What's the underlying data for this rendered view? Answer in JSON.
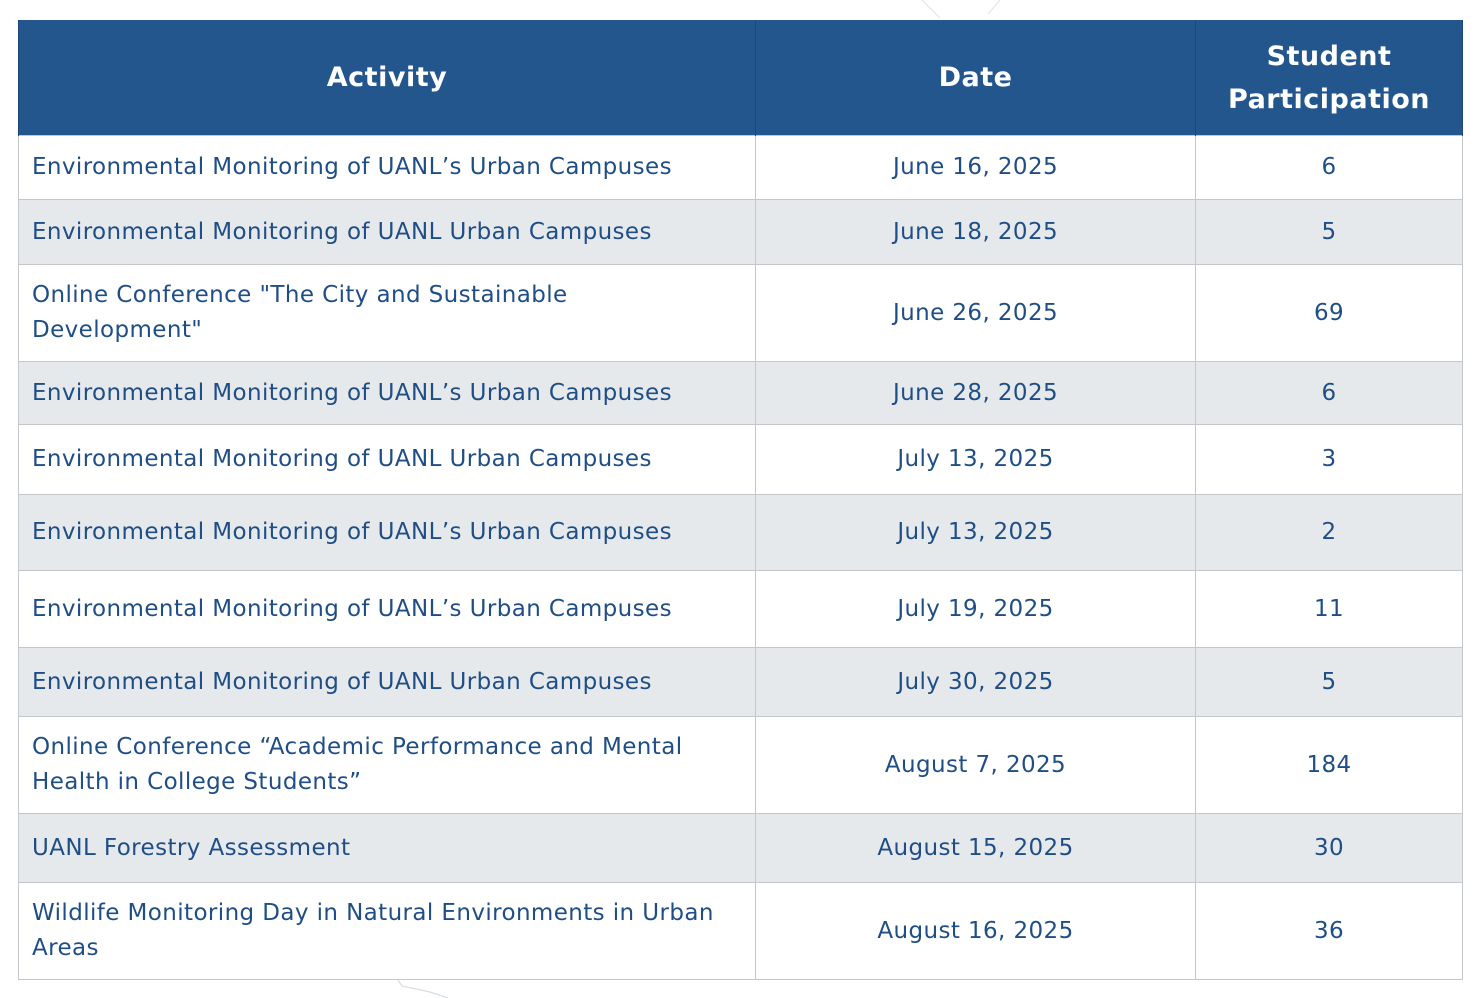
{
  "table": {
    "headers": {
      "activity": "Activity",
      "date": "Date",
      "participation": "Student Participation"
    },
    "rows": [
      {
        "activity": "Environmental Monitoring of UANL’s Urban Campuses",
        "date": "June 16, 2025",
        "participation": "6"
      },
      {
        "activity": "Environmental Monitoring of UANL Urban Campuses",
        "date": "June 18, 2025",
        "participation": "5"
      },
      {
        "activity": "Online Conference \"The City and Sustainable Development\"",
        "date": "June 26, 2025",
        "participation": "69"
      },
      {
        "activity": "Environmental Monitoring of UANL’s Urban Campuses",
        "date": "June 28, 2025",
        "participation": "6"
      },
      {
        "activity": "Environmental Monitoring of UANL Urban Campuses",
        "date": "July 13, 2025",
        "participation": "3"
      },
      {
        "activity": "Environmental Monitoring of UANL’s Urban Campuses",
        "date": "July 13, 2025",
        "participation": "2"
      },
      {
        "activity": "Environmental Monitoring of UANL’s Urban Campuses",
        "date": "July 19, 2025",
        "participation": "11"
      },
      {
        "activity": "Environmental Monitoring of UANL Urban Campuses",
        "date": "July 30, 2025",
        "participation": "5"
      },
      {
        "activity": "Online Conference “Academic Performance and Mental Health in College Students”",
        "date": "August 7, 2025",
        "participation": "184"
      },
      {
        "activity": "UANL Forestry Assessment",
        "date": "August 15, 2025",
        "participation": "30"
      },
      {
        "activity": "Wildlife Monitoring Day in Natural Environments in Urban Areas",
        "date": "August 16, 2025",
        "participation": "36"
      }
    ]
  },
  "colors": {
    "header_background": "#23568d",
    "header_text": "#ffffff",
    "body_text": "#1f4e86",
    "alternate_row": "#e6e9ec",
    "grid_line": "#c4c8cd"
  }
}
